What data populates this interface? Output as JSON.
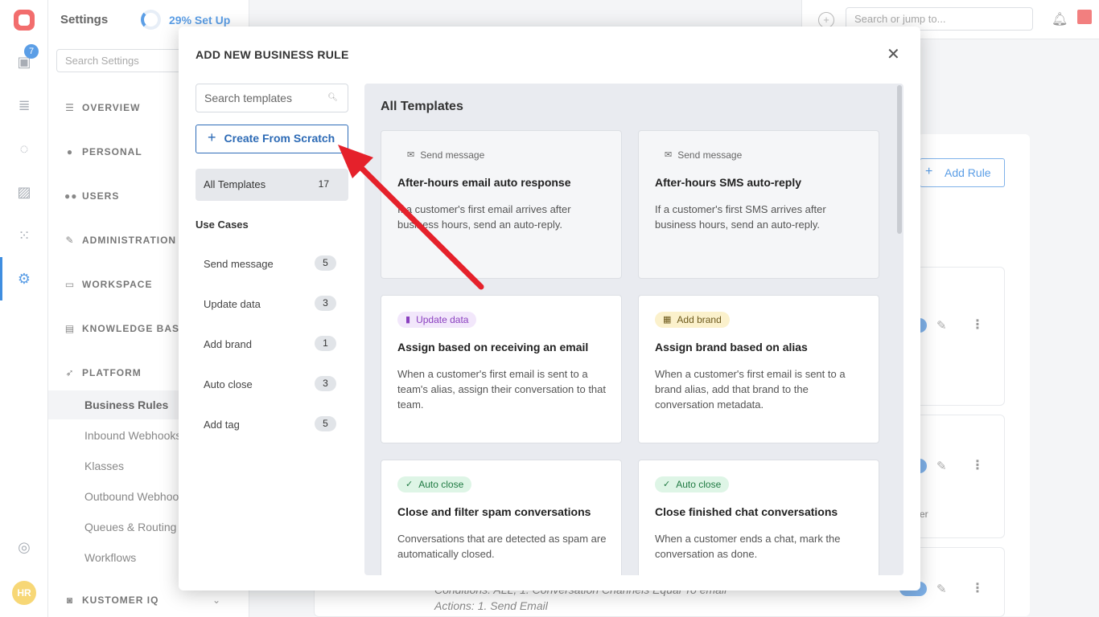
{
  "rail": {
    "inbox_badge": "7",
    "avatar_initials": "HR"
  },
  "settings": {
    "title": "Settings",
    "setup_label": "29% Set Up",
    "search_placeholder": "Search Settings",
    "sections": [
      "OVERVIEW",
      "PERSONAL",
      "USERS",
      "ADMINISTRATION",
      "WORKSPACE",
      "KNOWLEDGE BASE",
      "PLATFORM",
      "KUSTOMER IQ"
    ],
    "platform_items": [
      "Business Rules",
      "Inbound Webhooks",
      "Klasses",
      "Outbound Webhooks",
      "Queues & Routing",
      "Workflows"
    ]
  },
  "topbar": {
    "search_placeholder": "Search or jump to..."
  },
  "background": {
    "add_rule": "Add Rule",
    "conditions_text": "Conditions:  ALL, 1. Conversation Channels Equal To email",
    "actions_text": "Actions:  1. Send Email",
    "partial_text": "er"
  },
  "modal": {
    "title": "ADD NEW BUSINESS RULE",
    "search_placeholder": "Search templates",
    "create_from_scratch": "Create From Scratch",
    "all_templates": {
      "label": "All Templates",
      "count": "17"
    },
    "use_cases_heading": "Use Cases",
    "use_cases": [
      {
        "label": "Send message",
        "count": "5"
      },
      {
        "label": "Update data",
        "count": "3"
      },
      {
        "label": "Add brand",
        "count": "1"
      },
      {
        "label": "Auto close",
        "count": "3"
      },
      {
        "label": "Add tag",
        "count": "5"
      }
    ],
    "panel_title": "All Templates",
    "cards": [
      {
        "tag": "Send message",
        "title": "After-hours email auto response",
        "desc": "If a customer's first email arrives after business hours, send an auto-reply."
      },
      {
        "tag": "Send message",
        "title": "After-hours SMS auto-reply",
        "desc": "If a customer's first SMS arrives after business hours, send an auto-reply."
      },
      {
        "tag": "Update data",
        "title": "Assign based on receiving an email",
        "desc": "When a customer's first email is sent to a team's alias, assign their conversation to that team."
      },
      {
        "tag": "Add brand",
        "title": "Assign brand based on alias",
        "desc": "When a customer's first email is sent to a brand alias, add that brand to the conversation metadata."
      },
      {
        "tag": "Auto close",
        "title": "Close and filter spam conversations",
        "desc": "Conversations that are detected as spam are automatically closed."
      },
      {
        "tag": "Auto close",
        "title": "Close finished chat conversations",
        "desc": "When a customer ends a chat, mark the conversation as done."
      }
    ]
  },
  "colors": {
    "accent": "#2c6ab5",
    "annotation_arrow": "#e5212b"
  }
}
